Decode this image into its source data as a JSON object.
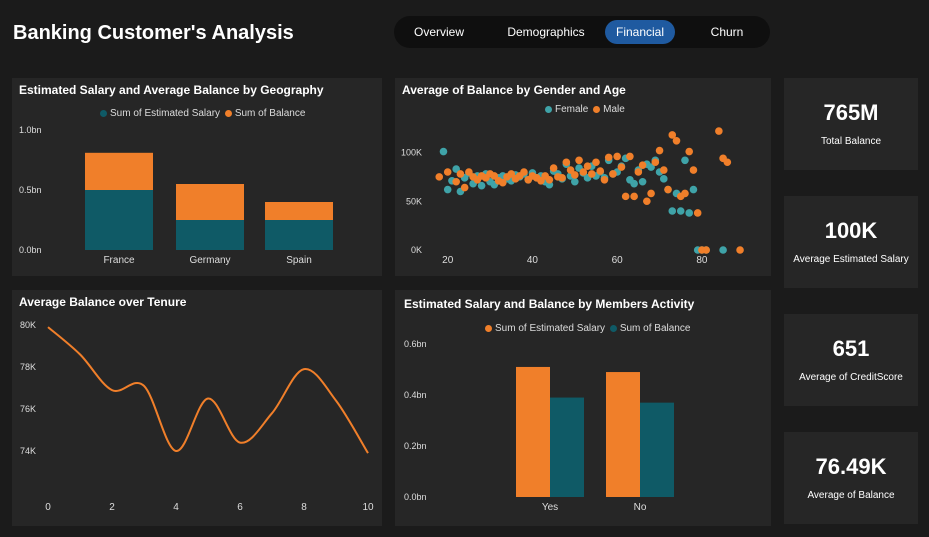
{
  "header": {
    "title": "Banking Customer's Analysis"
  },
  "nav": {
    "tabs": [
      {
        "label": "Overview",
        "active": false
      },
      {
        "label": "Demographics",
        "active": false
      },
      {
        "label": "Financial",
        "active": true
      },
      {
        "label": "Churn",
        "active": false
      }
    ]
  },
  "colors": {
    "teal": "#0f5a66",
    "orange": "#f07f2a",
    "scatter_teal": "#3fa3a8",
    "background": "#1b1b1b",
    "panel": "#262626",
    "active_tab": "#1f5aa0"
  },
  "kpis": [
    {
      "value": "765M",
      "label": "Total Balance"
    },
    {
      "value": "100K",
      "label": "Average Estimated Salary"
    },
    {
      "value": "651",
      "label": "Average of CreditScore"
    },
    {
      "value": "76.49K",
      "label": "Average of Balance"
    }
  ],
  "panels": {
    "geo": {
      "title": "Estimated Salary and Average Balance by Geography",
      "legend": [
        "Sum of Estimated Salary",
        "Sum of Balance"
      ]
    },
    "scatter": {
      "title": "Average of Balance by Gender and Age",
      "legend": [
        "Female",
        "Male"
      ]
    },
    "tenure": {
      "title": "Average Balance over Tenure"
    },
    "activity": {
      "title": "Estimated Salary and Balance by Members Activity",
      "legend": [
        "Sum of Estimated Salary",
        "Sum of Balance"
      ]
    }
  },
  "chart_data": [
    {
      "type": "bar",
      "title": "Estimated Salary and Average Balance by Geography",
      "stacked": true,
      "categories": [
        "France",
        "Germany",
        "Spain"
      ],
      "series": [
        {
          "name": "Sum of Estimated Salary",
          "values": [
            0.5,
            0.25,
            0.25
          ],
          "color": "#0f5a66"
        },
        {
          "name": "Sum of Balance",
          "values": [
            0.31,
            0.3,
            0.15
          ],
          "color": "#f07f2a"
        }
      ],
      "yticks": [
        "0.0bn",
        "0.5bn",
        "1.0bn"
      ],
      "ylim": [
        0,
        1.0
      ],
      "legend_position": "top-center"
    },
    {
      "type": "scatter",
      "title": "Average of Balance by Gender and Age",
      "xticks": [
        "20",
        "40",
        "60",
        "80"
      ],
      "yticks": [
        "0K",
        "50K",
        "100K"
      ],
      "xlim": [
        17,
        93
      ],
      "ylim": [
        0,
        120000
      ],
      "series": [
        {
          "name": "Female",
          "color": "#3fa3a8",
          "points": [
            [
              19,
              101000
            ],
            [
              20,
              62000
            ],
            [
              21,
              71000
            ],
            [
              22,
              83000
            ],
            [
              23,
              60000
            ],
            [
              24,
              74000
            ],
            [
              25,
              79000
            ],
            [
              26,
              68000
            ],
            [
              27,
              76000
            ],
            [
              28,
              66000
            ],
            [
              29,
              78000
            ],
            [
              30,
              70000
            ],
            [
              31,
              67000
            ],
            [
              32,
              74000
            ],
            [
              33,
              76000
            ],
            [
              34,
              73000
            ],
            [
              35,
              71000
            ],
            [
              36,
              77000
            ],
            [
              37,
              75000
            ],
            [
              38,
              78000
            ],
            [
              39,
              72000
            ],
            [
              40,
              79000
            ],
            [
              41,
              74000
            ],
            [
              42,
              76000
            ],
            [
              43,
              70000
            ],
            [
              44,
              67000
            ],
            [
              45,
              81000
            ],
            [
              46,
              78000
            ],
            [
              47,
              73000
            ],
            [
              48,
              88000
            ],
            [
              49,
              76000
            ],
            [
              50,
              70000
            ],
            [
              51,
              84000
            ],
            [
              52,
              79000
            ],
            [
              53,
              74000
            ],
            [
              54,
              86000
            ],
            [
              55,
              76000
            ],
            [
              56,
              80000
            ],
            [
              57,
              74000
            ],
            [
              58,
              92000
            ],
            [
              59,
              78000
            ],
            [
              60,
              80000
            ],
            [
              61,
              86000
            ],
            [
              62,
              94000
            ],
            [
              63,
              72000
            ],
            [
              64,
              68000
            ],
            [
              65,
              82000
            ],
            [
              66,
              70000
            ],
            [
              67,
              88000
            ],
            [
              68,
              85000
            ],
            [
              69,
              92000
            ],
            [
              70,
              80000
            ],
            [
              71,
              73000
            ],
            [
              72,
              62000
            ],
            [
              73,
              40000
            ],
            [
              74,
              58000
            ],
            [
              75,
              40000
            ],
            [
              76,
              92000
            ],
            [
              77,
              38000
            ],
            [
              78,
              62000
            ],
            [
              79,
              0
            ],
            [
              80,
              0
            ],
            [
              81,
              0
            ],
            [
              85,
              0
            ]
          ]
        },
        {
          "name": "Male",
          "color": "#f07f2a",
          "points": [
            [
              18,
              75000
            ],
            [
              20,
              80000
            ],
            [
              22,
              70000
            ],
            [
              23,
              78000
            ],
            [
              24,
              64000
            ],
            [
              25,
              80000
            ],
            [
              26,
              75000
            ],
            [
              27,
              72000
            ],
            [
              28,
              76000
            ],
            [
              29,
              74000
            ],
            [
              30,
              78000
            ],
            [
              31,
              76000
            ],
            [
              32,
              71000
            ],
            [
              33,
              69000
            ],
            [
              34,
              75000
            ],
            [
              35,
              78000
            ],
            [
              36,
              73000
            ],
            [
              37,
              76000
            ],
            [
              38,
              80000
            ],
            [
              39,
              72000
            ],
            [
              40,
              76000
            ],
            [
              41,
              74000
            ],
            [
              42,
              71000
            ],
            [
              43,
              76000
            ],
            [
              44,
              72000
            ],
            [
              45,
              84000
            ],
            [
              46,
              75000
            ],
            [
              47,
              74000
            ],
            [
              48,
              90000
            ],
            [
              49,
              82000
            ],
            [
              50,
              77000
            ],
            [
              51,
              92000
            ],
            [
              52,
              80000
            ],
            [
              53,
              86000
            ],
            [
              54,
              78000
            ],
            [
              55,
              90000
            ],
            [
              56,
              81000
            ],
            [
              57,
              72000
            ],
            [
              58,
              95000
            ],
            [
              59,
              78000
            ],
            [
              60,
              96000
            ],
            [
              61,
              85000
            ],
            [
              62,
              55000
            ],
            [
              63,
              96000
            ],
            [
              64,
              55000
            ],
            [
              65,
              80000
            ],
            [
              66,
              87000
            ],
            [
              67,
              50000
            ],
            [
              68,
              58000
            ],
            [
              69,
              90000
            ],
            [
              70,
              102000
            ],
            [
              71,
              82000
            ],
            [
              72,
              62000
            ],
            [
              73,
              118000
            ],
            [
              74,
              112000
            ],
            [
              75,
              55000
            ],
            [
              76,
              58000
            ],
            [
              77,
              101000
            ],
            [
              78,
              82000
            ],
            [
              79,
              38000
            ],
            [
              80,
              0
            ],
            [
              81,
              0
            ],
            [
              84,
              122000
            ],
            [
              85,
              94000
            ],
            [
              86,
              90000
            ],
            [
              89,
              0
            ]
          ]
        }
      ],
      "legend_position": "top-center"
    },
    {
      "type": "line",
      "title": "Average Balance over Tenure",
      "x": [
        0,
        1,
        2,
        3,
        4,
        5,
        6,
        7,
        8,
        9,
        10
      ],
      "series": [
        {
          "name": "",
          "values": [
            79900,
            78600,
            76900,
            77100,
            74000,
            76500,
            74400,
            75800,
            77900,
            76400,
            73900
          ],
          "color": "#f07f2a"
        }
      ],
      "xticks": [
        "0",
        "2",
        "4",
        "6",
        "8",
        "10"
      ],
      "yticks": [
        "74K",
        "76K",
        "78K",
        "80K"
      ],
      "xlim": [
        0,
        10
      ],
      "ylim": [
        73000,
        80000
      ]
    },
    {
      "type": "bar",
      "title": "Estimated Salary and Balance by Members Activity",
      "stacked": false,
      "categories": [
        "Yes",
        "No"
      ],
      "series": [
        {
          "name": "Sum of Estimated Salary",
          "values": [
            0.51,
            0.49
          ],
          "color": "#f07f2a"
        },
        {
          "name": "Sum of Balance",
          "values": [
            0.39,
            0.37
          ],
          "color": "#0f5a66"
        }
      ],
      "yticks": [
        "0.0bn",
        "0.2bn",
        "0.4bn",
        "0.6bn"
      ],
      "ylim": [
        0,
        0.6
      ],
      "legend_position": "top-center"
    }
  ]
}
